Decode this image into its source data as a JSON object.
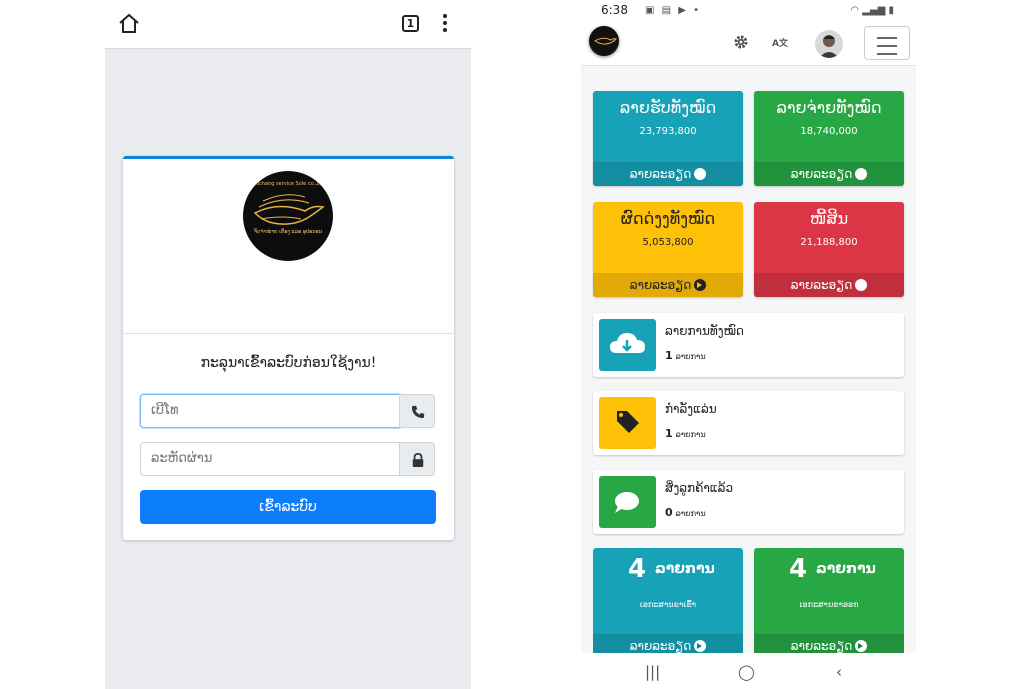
{
  "browser": {
    "tab_count": "1"
  },
  "login": {
    "logo_text_top": "Laochang service Sole co.,LTD",
    "logo_text_bottom": "ຈັດຈຳໜ່າຍ ເຄື່ອງ ແລະ ອຸປະກອນ",
    "prompt": "ກະລຸນາເຂົ້າລະບົບກ່ອນໃຊ້ງານ!",
    "phone_placeholder": "ເບີໂທ",
    "password_placeholder": "ລະຫັດຜ່ານ",
    "submit_label": "ເຂົ້າລະບົບ"
  },
  "status": {
    "time": "6:38"
  },
  "dashboard": {
    "lang_label": "A文",
    "stats": [
      {
        "label": "ລາຍຮັບທັງໝົດ",
        "value": "23,793,800",
        "more": "ລາຍລະອຽດ"
      },
      {
        "label": "ລາຍຈ່າຍທັງໝົດ",
        "value": "18,740,000",
        "more": "ລາຍລະອຽດ"
      },
      {
        "label": "ຜົດດ່ງງທັງໝົດ",
        "value": "5,053,800",
        "more": "ລາຍລະອຽດ"
      },
      {
        "label": "ໜີ້ສິນ",
        "value": "21,188,800",
        "more": "ລາຍລະອຽດ"
      }
    ],
    "info": [
      {
        "title": "ລາຍການທັງໝົດ",
        "count": "1",
        "unit": "ລາຍການ"
      },
      {
        "title": "ກຳລັງແລ່ນ",
        "count": "1",
        "unit": "ລາຍການ"
      },
      {
        "title": "ສິ່ງລູກຄ້າແລ້ວ",
        "count": "0",
        "unit": "ລາຍການ"
      }
    ],
    "big": [
      {
        "count": "4",
        "unit": "ລາຍການ",
        "sub": "ເອກະສານຂາເຂົ້າ",
        "more": "ລາຍລະອຽດ"
      },
      {
        "count": "4",
        "unit": "ລາຍການ",
        "sub": "ເອກະສານຂາອອກ",
        "more": "ລາຍລະອຽດ"
      }
    ]
  },
  "colors": {
    "teal": "#17a2b8",
    "green": "#28a745",
    "yellow": "#ffc107",
    "red": "#dc3545",
    "primary": "#0d7efb"
  }
}
